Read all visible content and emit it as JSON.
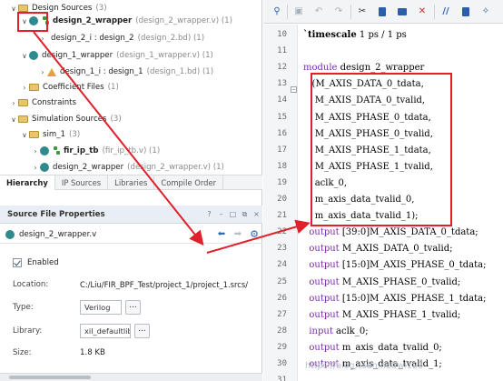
{
  "tree": {
    "items": [
      {
        "label": "Design Sources",
        "extra": "(3)",
        "arrow": "∨"
      },
      {
        "label": "design_2_wrapper",
        "extra": "(design_2_wrapper.v) (1)",
        "arrow": "∨"
      },
      {
        "label": "design_2_i : design_2",
        "extra": "(design_2.bd) (1)",
        "arrow": "›"
      },
      {
        "label": "design_1_wrapper",
        "extra": "(design_1_wrapper.v) (1)",
        "arrow": "∨"
      },
      {
        "label": "design_1_i : design_1",
        "extra": "(design_1.bd) (1)",
        "arrow": "›"
      },
      {
        "label": "Coefficient Files",
        "extra": "(1)",
        "arrow": "›"
      },
      {
        "label": "Constraints",
        "extra": "",
        "arrow": "›"
      },
      {
        "label": "Simulation Sources",
        "extra": "(3)",
        "arrow": "∨"
      },
      {
        "label": "sim_1",
        "extra": "(3)",
        "arrow": "∨"
      },
      {
        "label": "fir_ip_tb",
        "extra": "(fir_ip_tb.v) (1)",
        "arrow": "›"
      },
      {
        "label": "design_2_wrapper",
        "extra": "(design_2_wrapper.v) (1)",
        "arrow": "›"
      }
    ]
  },
  "tabs": [
    "Hierarchy",
    "IP Sources",
    "Libraries",
    "Compile Order"
  ],
  "sfp": {
    "title": "Source File Properties",
    "file": "design_2_wrapper.v",
    "enabled_label": "Enabled",
    "location_label": "Location:",
    "location_value": "C:/Liu/FIR_BPF_Test/project_1/project_1.srcs/",
    "type_label": "Type:",
    "type_value": "Verilog",
    "library_label": "Library:",
    "library_value": "xil_defaultlib",
    "size_label": "Size:",
    "size_value": "1.8 KB",
    "dots": "..."
  },
  "editor": {
    "line_numbers": [
      "10",
      "11",
      "12",
      "13",
      "14",
      "15",
      "16",
      "17",
      "18",
      "19",
      "20",
      "21",
      "22",
      "23",
      "24",
      "25",
      "26",
      "27",
      "28",
      "29",
      "30",
      "31"
    ],
    "lines": [
      [
        {
          "t": "`timescale",
          "c": "ts"
        },
        {
          "t": " 1 ps / 1 ps",
          "c": ""
        }
      ],
      [
        {
          "t": "",
          "c": ""
        }
      ],
      [
        {
          "t": "module",
          "c": "kw"
        },
        {
          "t": " design_2_wrapper",
          "c": ""
        }
      ],
      [
        {
          "t": "   (M_AXIS_DATA_0_tdata,",
          "c": ""
        }
      ],
      [
        {
          "t": "    M_AXIS_DATA_0_tvalid,",
          "c": ""
        }
      ],
      [
        {
          "t": "    M_AXIS_PHASE_0_tdata,",
          "c": ""
        }
      ],
      [
        {
          "t": "    M_AXIS_PHASE_0_tvalid,",
          "c": ""
        }
      ],
      [
        {
          "t": "    M_AXIS_PHASE_1_tdata,",
          "c": ""
        }
      ],
      [
        {
          "t": "    M_AXIS_PHASE_1_tvalid,",
          "c": ""
        }
      ],
      [
        {
          "t": "    aclk_0,",
          "c": ""
        }
      ],
      [
        {
          "t": "    m_axis_data_tvalid_0,",
          "c": ""
        }
      ],
      [
        {
          "t": "    m_axis_data_tvalid_1);",
          "c": ""
        }
      ],
      [
        {
          "t": "  output",
          "c": "kw"
        },
        {
          "t": " [39:0]M_AXIS_DATA_0_tdata;",
          "c": ""
        }
      ],
      [
        {
          "t": "  output",
          "c": "kw"
        },
        {
          "t": " M_AXIS_DATA_0_tvalid;",
          "c": ""
        }
      ],
      [
        {
          "t": "  output",
          "c": "kw"
        },
        {
          "t": " [15:0]M_AXIS_PHASE_0_tdata;",
          "c": ""
        }
      ],
      [
        {
          "t": "  output",
          "c": "kw"
        },
        {
          "t": " M_AXIS_PHASE_0_tvalid;",
          "c": ""
        }
      ],
      [
        {
          "t": "  output",
          "c": "kw"
        },
        {
          "t": " [15:0]M_AXIS_PHASE_1_tdata;",
          "c": ""
        }
      ],
      [
        {
          "t": "  output",
          "c": "kw"
        },
        {
          "t": " M_AXIS_PHASE_1_tvalid;",
          "c": ""
        }
      ],
      [
        {
          "t": "  input",
          "c": "kw"
        },
        {
          "t": " aclk_0;",
          "c": ""
        }
      ],
      [
        {
          "t": "  output",
          "c": "kw"
        },
        {
          "t": " m_axis_data_tvalid_0;",
          "c": ""
        }
      ],
      [
        {
          "t": "  output",
          "c": "kw"
        },
        {
          "t": " m_axis_data_tvalid_1;",
          "c": ""
        }
      ],
      [
        {
          "t": "",
          "c": ""
        }
      ]
    ]
  },
  "watermark": "https://blog.csdn.net/wl123",
  "colors": {
    "annotation": "#e0202a",
    "keyword": "#7b2aa6",
    "accent": "#2c5fa8"
  }
}
